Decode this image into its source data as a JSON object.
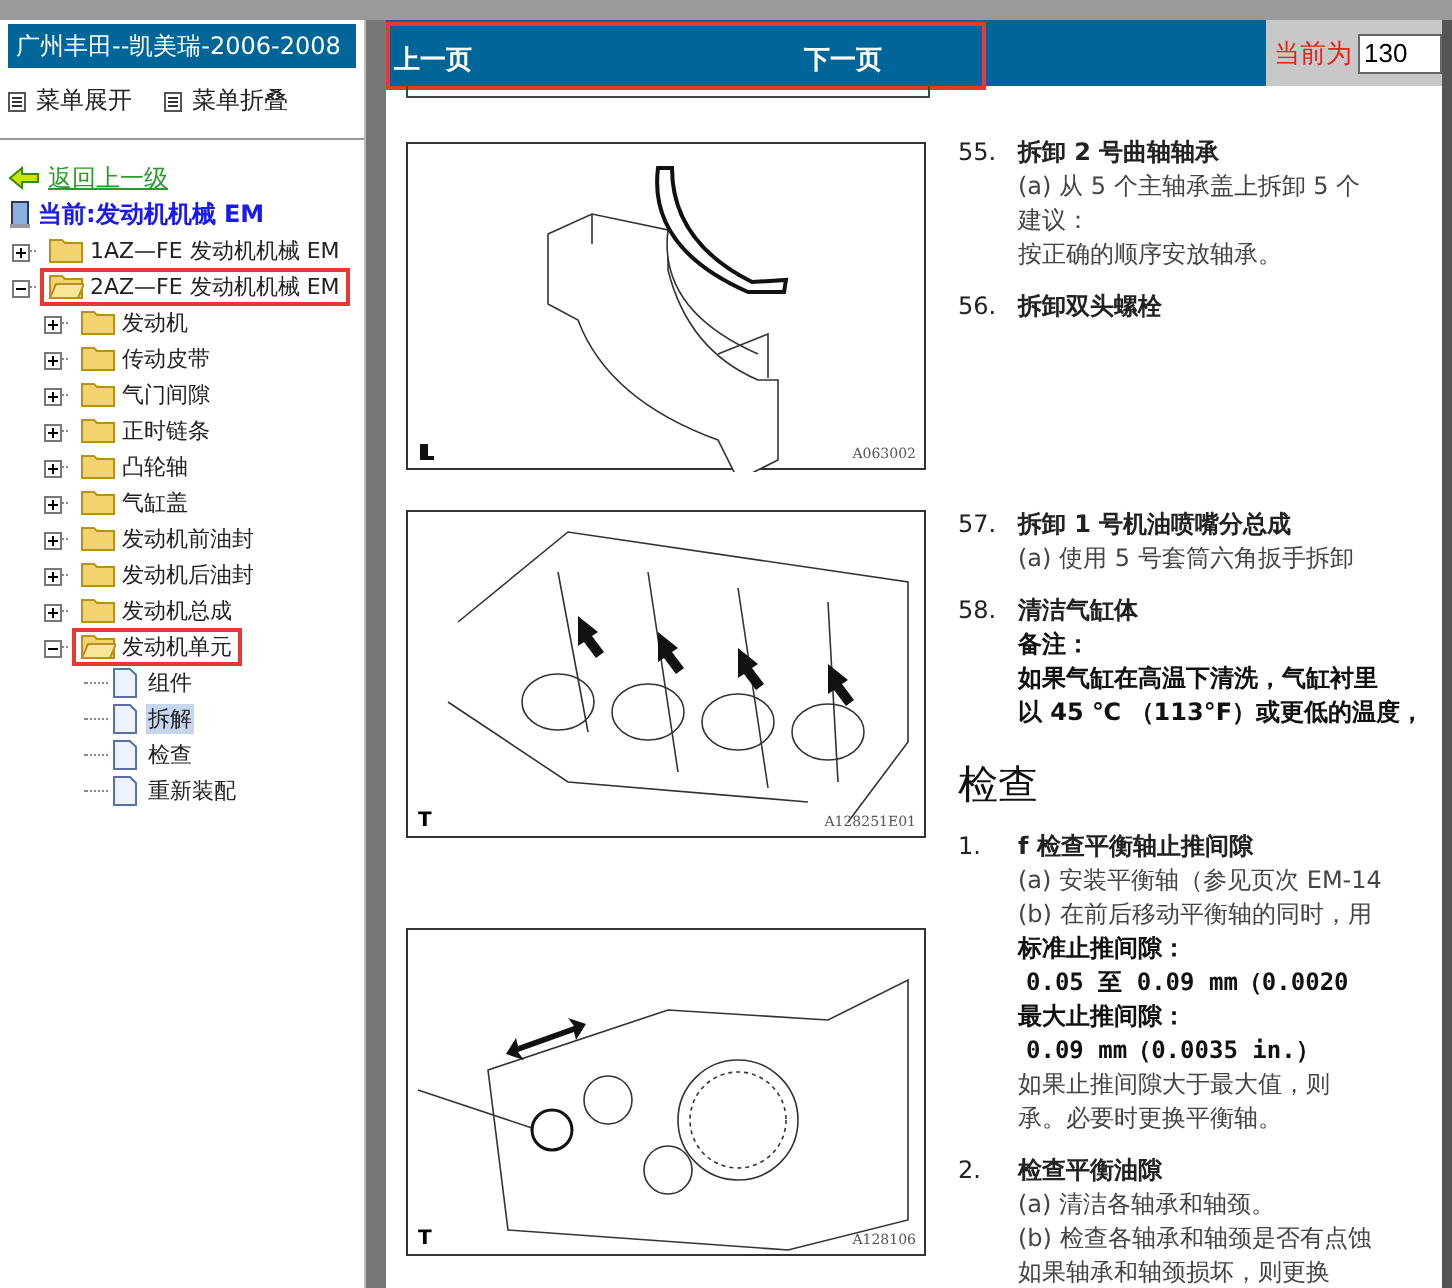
{
  "sidebar": {
    "title": "广州丰田--凯美瑞-2006-2008",
    "menu_buttons": [
      {
        "label": "菜单展开"
      },
      {
        "label": "菜单折叠"
      }
    ],
    "back_link": "返回上一级",
    "current": "当前:发动机机械 EM",
    "tree": [
      {
        "label": "1AZ—FE 发动机机械 EM",
        "expanded": false,
        "highlighted": false
      },
      {
        "label": "2AZ—FE 发动机机械 EM",
        "expanded": true,
        "highlighted": true,
        "children": [
          {
            "label": "发动机",
            "expanded": false,
            "highlighted": false
          },
          {
            "label": "传动皮带",
            "expanded": false,
            "highlighted": false
          },
          {
            "label": "气门间隙",
            "expanded": false,
            "highlighted": false
          },
          {
            "label": "正时链条",
            "expanded": false,
            "highlighted": false
          },
          {
            "label": "凸轮轴",
            "expanded": false,
            "highlighted": false
          },
          {
            "label": "气缸盖",
            "expanded": false,
            "highlighted": false
          },
          {
            "label": "发动机前油封",
            "expanded": false,
            "highlighted": false
          },
          {
            "label": "发动机后油封",
            "expanded": false,
            "highlighted": false
          },
          {
            "label": "发动机总成",
            "expanded": false,
            "highlighted": false
          },
          {
            "label": "发动机单元",
            "expanded": true,
            "highlighted": true,
            "children": [
              {
                "label": "组件",
                "selected": false
              },
              {
                "label": "拆解",
                "selected": true
              },
              {
                "label": "检查",
                "selected": false
              },
              {
                "label": "重新装配",
                "selected": false
              }
            ]
          }
        ]
      }
    ]
  },
  "header": {
    "prev": "上一页",
    "next": "下一页",
    "highlighted": true,
    "page_label": "当前为",
    "page_value": "130"
  },
  "figures": [
    {
      "kind": "bearing",
      "corner": {
        "kind": "icon"
      },
      "code": "A063002"
    },
    {
      "kind": "oil-jets",
      "corner": {
        "kind": "text",
        "text": "T"
      },
      "code": "A128251E01"
    },
    {
      "kind": "gauge",
      "corner": {
        "kind": "text",
        "text": "T"
      },
      "code": "A128106"
    }
  ],
  "sections": [
    {
      "items": [
        {
          "kind": "step",
          "number": "55.",
          "title": "拆卸 2 号曲轴轴承",
          "lines": [
            {
              "kind": "sub",
              "marker": "(a)",
              "text": "从 5 个主轴承盖上拆卸 5 个"
            },
            {
              "kind": "plain",
              "text": "建议："
            },
            {
              "kind": "plain",
              "text": "按正确的顺序安放轴承。"
            }
          ]
        },
        {
          "kind": "step",
          "number": "56.",
          "title": "拆卸双头螺栓"
        }
      ]
    },
    {
      "items": [
        {
          "kind": "step",
          "number": "57.",
          "title": "拆卸 1 号机油喷嘴分总成",
          "lines": [
            {
              "kind": "sub",
              "marker": "(a)",
              "text": "使用 5 号套筒六角扳手拆卸"
            }
          ]
        },
        {
          "kind": "step",
          "number": "58.",
          "title": "清洁气缸体",
          "lines": [
            {
              "kind": "bold",
              "text": "备注："
            },
            {
              "kind": "bold",
              "text": "如果气缸在高温下清洗，气缸衬里"
            },
            {
              "kind": "bold",
              "text": "以 45 ℃ （113°F）或更低的温度，"
            }
          ]
        },
        {
          "kind": "heading",
          "title": "检查"
        },
        {
          "kind": "step",
          "number": "1.",
          "title": "f 检查平衡轴止推间隙",
          "lines": [
            {
              "kind": "sub",
              "marker": "(a)",
              "text": "安装平衡轴（参见页次 EM-14"
            },
            {
              "kind": "sub",
              "marker": "(b)",
              "text": "在前后移动平衡轴的同时，用"
            },
            {
              "kind": "bold",
              "text": "标准止推间隙："
            },
            {
              "kind": "value",
              "text": "0.05 至 0.09 mm（0.0020"
            },
            {
              "kind": "bold",
              "text": "最大止推间隙："
            },
            {
              "kind": "value",
              "text": "0.09 mm（0.0035 in.）"
            },
            {
              "kind": "plain",
              "text": "如果止推间隙大于最大值，则"
            },
            {
              "kind": "plain",
              "text": "承。必要时更换平衡轴。"
            }
          ]
        },
        {
          "kind": "step",
          "number": "2.",
          "title": "检查平衡油隙",
          "lines": [
            {
              "kind": "sub",
              "marker": "(a)",
              "text": "清洁各轴承和轴颈。"
            },
            {
              "kind": "sub",
              "marker": "(b)",
              "text": "检查各轴承和轴颈是否有点蚀"
            },
            {
              "kind": "plain",
              "text": "如果轴承和轴颈损坏，则更换"
            }
          ]
        }
      ]
    }
  ]
}
